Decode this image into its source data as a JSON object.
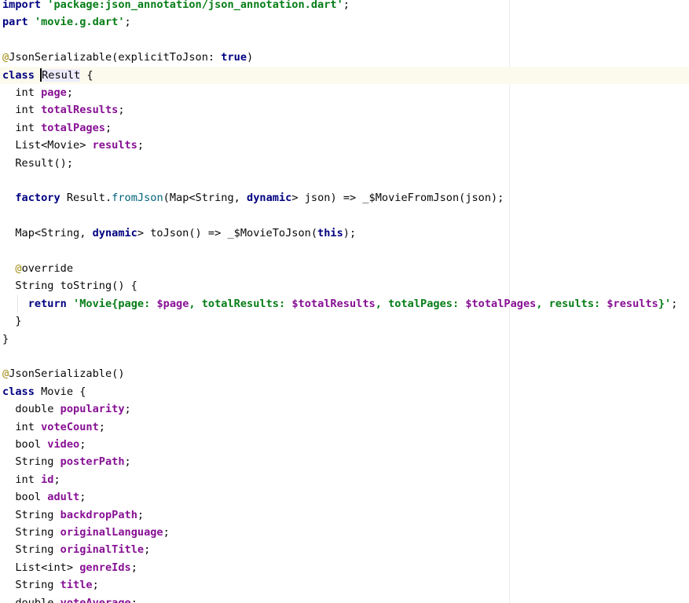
{
  "lines": [
    {
      "y": 0,
      "tokens": [
        {
          "t": "import",
          "c": "kw"
        },
        {
          "t": " ",
          "c": "plain"
        },
        {
          "t": "'package:json_annotation/json_annotation.dart'",
          "c": "str"
        },
        {
          "t": ";",
          "c": "punct"
        }
      ]
    },
    {
      "y": 1,
      "tokens": [
        {
          "t": "part",
          "c": "kw"
        },
        {
          "t": " ",
          "c": "plain"
        },
        {
          "t": "'movie.g.dart'",
          "c": "str"
        },
        {
          "t": ";",
          "c": "punct"
        }
      ]
    },
    {
      "y": 2,
      "tokens": []
    },
    {
      "y": 3,
      "tokens": [
        {
          "t": "@",
          "c": "ann"
        },
        {
          "t": "JsonSerializable(explicitToJson: ",
          "c": "plain"
        },
        {
          "t": "true",
          "c": "kw"
        },
        {
          "t": ")",
          "c": "plain"
        }
      ]
    },
    {
      "y": 4,
      "current": true,
      "tokens": [
        {
          "t": "class",
          "c": "kw"
        },
        {
          "t": " ",
          "c": "plain"
        },
        {
          "t": "Result",
          "c": "sym-ref",
          "caret": true
        },
        {
          "t": " {",
          "c": "plain"
        }
      ]
    },
    {
      "y": 5,
      "tokens": [
        {
          "t": "  int ",
          "c": "plain"
        },
        {
          "t": "page",
          "c": "field"
        },
        {
          "t": ";",
          "c": "punct"
        }
      ]
    },
    {
      "y": 6,
      "tokens": [
        {
          "t": "  int ",
          "c": "plain"
        },
        {
          "t": "totalResults",
          "c": "field"
        },
        {
          "t": ";",
          "c": "punct"
        }
      ]
    },
    {
      "y": 7,
      "tokens": [
        {
          "t": "  int ",
          "c": "plain"
        },
        {
          "t": "totalPages",
          "c": "field"
        },
        {
          "t": ";",
          "c": "punct"
        }
      ]
    },
    {
      "y": 8,
      "tokens": [
        {
          "t": "  List<Movie> ",
          "c": "plain"
        },
        {
          "t": "results",
          "c": "field"
        },
        {
          "t": ";",
          "c": "punct"
        }
      ]
    },
    {
      "y": 9,
      "tokens": [
        {
          "t": "  Result();",
          "c": "plain"
        }
      ]
    },
    {
      "y": 10,
      "tokens": []
    },
    {
      "y": 11,
      "tokens": [
        {
          "t": "  ",
          "c": "plain"
        },
        {
          "t": "factory",
          "c": "kw"
        },
        {
          "t": " Result.",
          "c": "plain"
        },
        {
          "t": "fromJson",
          "c": "method-call"
        },
        {
          "t": "(Map<String, ",
          "c": "plain"
        },
        {
          "t": "dynamic",
          "c": "kw"
        },
        {
          "t": "> json) => _$MovieFromJson(json);",
          "c": "plain"
        }
      ]
    },
    {
      "y": 12,
      "tokens": []
    },
    {
      "y": 13,
      "tokens": [
        {
          "t": "  Map<String, ",
          "c": "plain"
        },
        {
          "t": "dynamic",
          "c": "kw"
        },
        {
          "t": "> toJson() => _$MovieToJson(",
          "c": "plain"
        },
        {
          "t": "this",
          "c": "kw"
        },
        {
          "t": ");",
          "c": "plain"
        }
      ]
    },
    {
      "y": 14,
      "tokens": []
    },
    {
      "y": 15,
      "tokens": [
        {
          "t": "  ",
          "c": "plain"
        },
        {
          "t": "@",
          "c": "ann"
        },
        {
          "t": "override",
          "c": "plain"
        }
      ]
    },
    {
      "y": 16,
      "tokens": [
        {
          "t": "  String toString() {",
          "c": "plain"
        }
      ]
    },
    {
      "y": 17,
      "guide": true,
      "tokens": [
        {
          "t": "    ",
          "c": "plain"
        },
        {
          "t": "return",
          "c": "kw"
        },
        {
          "t": " ",
          "c": "plain"
        },
        {
          "t": "'Movie{page: ",
          "c": "str"
        },
        {
          "t": "$page",
          "c": "field"
        },
        {
          "t": ", totalResults: ",
          "c": "str"
        },
        {
          "t": "$totalResults",
          "c": "field"
        },
        {
          "t": ", totalPages: ",
          "c": "str"
        },
        {
          "t": "$totalPages",
          "c": "field"
        },
        {
          "t": ", results: ",
          "c": "str"
        },
        {
          "t": "$results",
          "c": "field"
        },
        {
          "t": "}'",
          "c": "str"
        },
        {
          "t": ";",
          "c": "punct"
        }
      ]
    },
    {
      "y": 18,
      "tokens": [
        {
          "t": "  }",
          "c": "plain"
        }
      ]
    },
    {
      "y": 19,
      "tokens": [
        {
          "t": "}",
          "c": "plain"
        }
      ]
    },
    {
      "y": 20,
      "tokens": []
    },
    {
      "y": 21,
      "tokens": [
        {
          "t": "@",
          "c": "ann"
        },
        {
          "t": "JsonSerializable()",
          "c": "plain"
        }
      ]
    },
    {
      "y": 22,
      "tokens": [
        {
          "t": "class",
          "c": "kw"
        },
        {
          "t": " Movie {",
          "c": "plain"
        }
      ]
    },
    {
      "y": 23,
      "tokens": [
        {
          "t": "  double ",
          "c": "plain"
        },
        {
          "t": "popularity",
          "c": "field"
        },
        {
          "t": ";",
          "c": "punct"
        }
      ]
    },
    {
      "y": 24,
      "tokens": [
        {
          "t": "  int ",
          "c": "plain"
        },
        {
          "t": "voteCount",
          "c": "field"
        },
        {
          "t": ";",
          "c": "punct"
        }
      ]
    },
    {
      "y": 25,
      "tokens": [
        {
          "t": "  bool ",
          "c": "plain"
        },
        {
          "t": "video",
          "c": "field"
        },
        {
          "t": ";",
          "c": "punct"
        }
      ]
    },
    {
      "y": 26,
      "tokens": [
        {
          "t": "  String ",
          "c": "plain"
        },
        {
          "t": "posterPath",
          "c": "field"
        },
        {
          "t": ";",
          "c": "punct"
        }
      ]
    },
    {
      "y": 27,
      "tokens": [
        {
          "t": "  int ",
          "c": "plain"
        },
        {
          "t": "id",
          "c": "field"
        },
        {
          "t": ";",
          "c": "punct"
        }
      ]
    },
    {
      "y": 28,
      "tokens": [
        {
          "t": "  bool ",
          "c": "plain"
        },
        {
          "t": "adult",
          "c": "field"
        },
        {
          "t": ";",
          "c": "punct"
        }
      ]
    },
    {
      "y": 29,
      "tokens": [
        {
          "t": "  String ",
          "c": "plain"
        },
        {
          "t": "backdropPath",
          "c": "field"
        },
        {
          "t": ";",
          "c": "punct"
        }
      ]
    },
    {
      "y": 30,
      "tokens": [
        {
          "t": "  String ",
          "c": "plain"
        },
        {
          "t": "originalLanguage",
          "c": "field"
        },
        {
          "t": ";",
          "c": "punct"
        }
      ]
    },
    {
      "y": 31,
      "tokens": [
        {
          "t": "  String ",
          "c": "plain"
        },
        {
          "t": "originalTitle",
          "c": "field"
        },
        {
          "t": ";",
          "c": "punct"
        }
      ]
    },
    {
      "y": 32,
      "tokens": [
        {
          "t": "  List<int> ",
          "c": "plain"
        },
        {
          "t": "genreIds",
          "c": "field"
        },
        {
          "t": ";",
          "c": "punct"
        }
      ]
    },
    {
      "y": 33,
      "tokens": [
        {
          "t": "  String ",
          "c": "plain"
        },
        {
          "t": "title",
          "c": "field"
        },
        {
          "t": ";",
          "c": "punct"
        }
      ]
    },
    {
      "y": 34,
      "tokens": [
        {
          "t": "  double ",
          "c": "plain"
        },
        {
          "t": "voteAverage",
          "c": "field"
        },
        {
          "t": ";",
          "c": "punct"
        }
      ]
    }
  ]
}
